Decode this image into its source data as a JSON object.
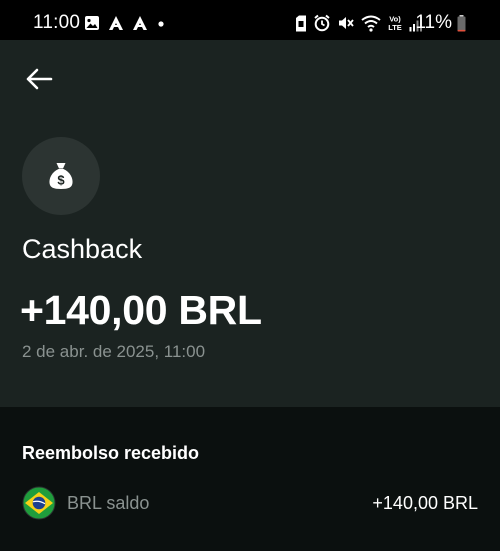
{
  "status_bar": {
    "time": "11:00",
    "battery_percent": "11%",
    "battery_level": 0.11,
    "left_icons": [
      "gallery-icon",
      "app-a-icon",
      "app-a-icon",
      "dot-icon"
    ],
    "right_icons": [
      "sim-icon",
      "alarm-icon",
      "mute-icon",
      "wifi-icon",
      "volte-icon",
      "signal-icon",
      "battery-icon"
    ]
  },
  "header": {
    "back_icon": "arrow-left-icon",
    "avatar_icon": "money-bag-icon",
    "transaction_type": "Cashback",
    "amount": "+140,00 BRL",
    "date": "2 de abr. de 2025, 11:00"
  },
  "details": {
    "section_title": "Reembolso recebido",
    "rows": [
      {
        "flag_icon": "brazil-flag-icon",
        "label": "BRL saldo",
        "value": "+140,00 BRL"
      }
    ]
  },
  "colors": {
    "status_bar_bg": "#000000",
    "header_bg": "#1b2321",
    "page_bg": "#0b100f",
    "avatar_bg": "#2c3432",
    "muted_text": "#8a9290",
    "battery_low": "#e0503c"
  }
}
